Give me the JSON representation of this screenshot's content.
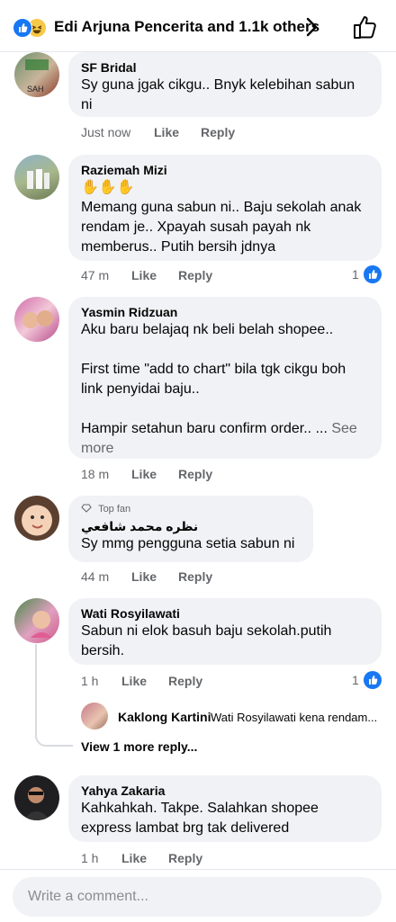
{
  "header": {
    "reactors_text": "Edi Arjuna Pencerita and 1.1k others"
  },
  "comments": [
    {
      "name": "SF Bridal",
      "text": "Sy guna jgak cikgu.. Bnyk kelebihan sabun\nni",
      "time": "Just now",
      "like_label": "Like",
      "reply_label": "Reply"
    },
    {
      "name": "Raziemah Mizi",
      "emoji": "✋✋✋",
      "text": "Memang guna sabun ni.. Baju sekolah anak\nrendam je.. Xpayah susah payah nk\nmemberus.. Putih bersih jdnya",
      "time": "47 m",
      "like_label": "Like",
      "reply_label": "Reply",
      "reaction_count": "1"
    },
    {
      "name": "Yasmin Ridzuan",
      "text": "Aku baru belajaq nk beli belah shopee..\n\nFirst time \"add to chart\" bila tgk cikgu boh\nlink penyidai baju..\n\nHampir setahun baru confirm order.. ...",
      "see_more": "See more",
      "time": "18 m",
      "like_label": "Like",
      "reply_label": "Reply"
    },
    {
      "badge": "Top fan",
      "name": "نظره محمد شافعي",
      "text": "Sy mmg pengguna setia sabun ni",
      "time": "44 m",
      "like_label": "Like",
      "reply_label": "Reply"
    },
    {
      "name": "Wati Rosyilawati",
      "text": "Sabun ni elok basuh baju sekolah.putih\nbersih.",
      "time": "1 h",
      "like_label": "Like",
      "reply_label": "Reply",
      "reaction_count": "1",
      "reply_preview": {
        "name": "Kaklong Kartini",
        "text": "Wati Rosyilawati kena rendam..."
      },
      "view_more": "View 1 more reply..."
    },
    {
      "name": "Yahya Zakaria",
      "text": "Kahkahkah. Takpe. Salahkan shopee\nexpress lambat brg tak delivered",
      "time": "1 h",
      "like_label": "Like",
      "reply_label": "Reply"
    }
  ],
  "composer": {
    "placeholder": "Write a comment..."
  },
  "colors": {
    "accent": "#1877f2",
    "bubble": "#f0f2f5",
    "meta": "#65676b"
  }
}
